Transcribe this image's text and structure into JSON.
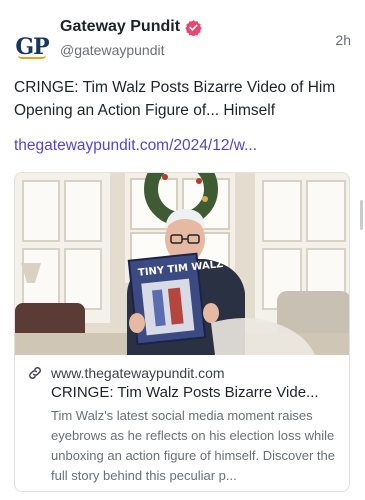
{
  "post": {
    "author_name": "Gateway Pundit",
    "handle": "@gatewaypundit",
    "time_ago": "2h",
    "avatar_text": "GP",
    "text": "CRINGE: Tim Walz Posts Bizarre Video of Him Opening an Action Figure of... Himself",
    "link_text": "thegatewaypundit.com/2024/12/w...",
    "card": {
      "domain": "www.thegatewaypundit.com",
      "title": "CRINGE: Tim Walz Posts Bizarre Vide...",
      "description": "Tim Walz's latest social media moment raises eyebrows as he reflects on his election loss while unboxing an action figure of himself. Discover the full story behind this peculiar p...",
      "image_box_text": "TINY TIM WALZ"
    }
  },
  "colors": {
    "link": "#5646c6",
    "verified_badge": "#e8476d",
    "avatar_navy": "#17365f",
    "avatar_gold": "#e0a51a"
  },
  "icons": [
    "verified-badge-icon",
    "link-icon"
  ]
}
